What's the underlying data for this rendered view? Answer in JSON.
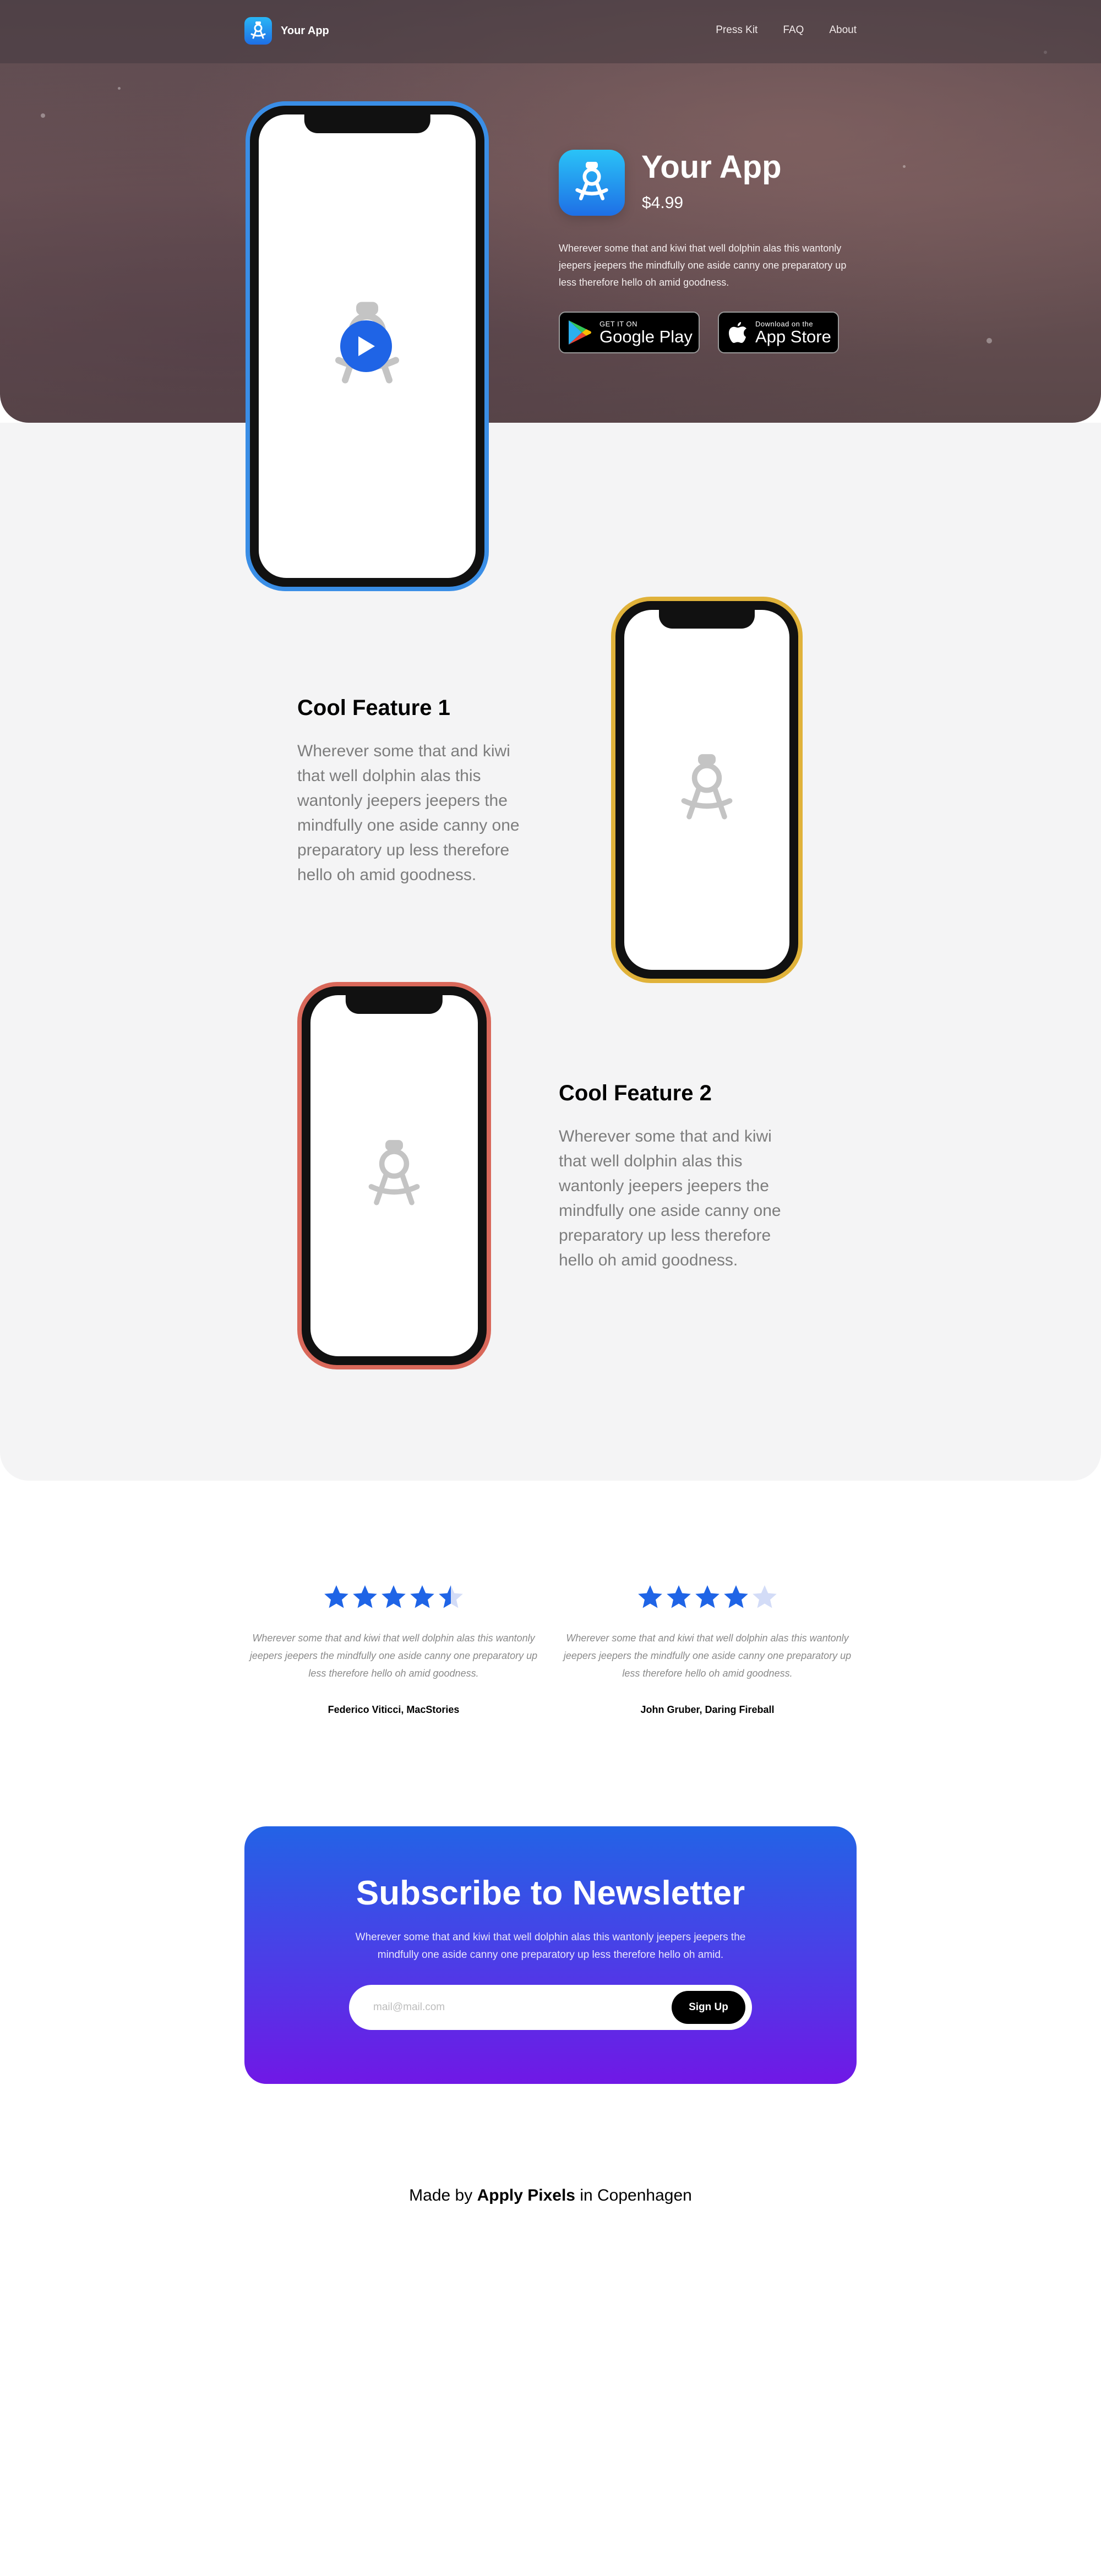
{
  "nav": {
    "brand_name": "Your App",
    "links": [
      "Press Kit",
      "FAQ",
      "About"
    ]
  },
  "hero": {
    "app_name": "Your App",
    "price": "$4.99",
    "description": "Wherever some that and kiwi that well dolphin alas this wantonly jeepers jeepers the mindfully one aside canny one preparatory up less therefore hello oh amid goodness.",
    "google_play": {
      "small": "GET IT ON",
      "big": "Google Play"
    },
    "app_store": {
      "small": "Download on the",
      "big": "App Store"
    },
    "phone_color": "#3a8ee6"
  },
  "features": [
    {
      "title": "Cool Feature 1",
      "text": "Wherever some that and kiwi that well dolphin alas this wantonly jeepers jeepers the mindfully one aside canny one preparatory up less therefore hello oh amid goodness.",
      "phone_color": "#e0b23a"
    },
    {
      "title": "Cool Feature 2",
      "text": "Wherever some that and kiwi that well dolphin alas this wantonly jeepers jeepers the mindfully one aside canny one preparatory up less therefore hello oh amid goodness.",
      "phone_color": "#d9685a"
    }
  ],
  "reviews": [
    {
      "rating": 4.5,
      "text": "Wherever some that and kiwi that well dolphin alas this wantonly jeepers jeepers the mindfully one aside canny one preparatory up less therefore hello oh amid goodness.",
      "author": "Federico Viticci, MacStories"
    },
    {
      "rating": 4,
      "text": "Wherever some that and kiwi that well dolphin alas this wantonly jeepers jeepers the mindfully one aside canny one preparatory up less therefore hello oh amid goodness.",
      "author": "John Gruber, Daring Fireball"
    }
  ],
  "newsletter": {
    "title": "Subscribe to Newsletter",
    "text": "Wherever some that and kiwi that well dolphin alas this wantonly jeepers jeepers the mindfully one aside canny one preparatory up less therefore hello oh amid.",
    "placeholder": "mail@mail.com",
    "button": "Sign Up"
  },
  "footer": {
    "prefix": "Made by",
    "company": "Apply Pixels",
    "suffix": "in Copenhagen"
  },
  "colors": {
    "accent": "#1f64e6",
    "star_filled": "#1f64e6",
    "star_empty": "#d3dcf7"
  },
  "icons": [
    "app-logo-icon",
    "play-icon",
    "google-play-icon",
    "apple-icon",
    "star-icon"
  ]
}
